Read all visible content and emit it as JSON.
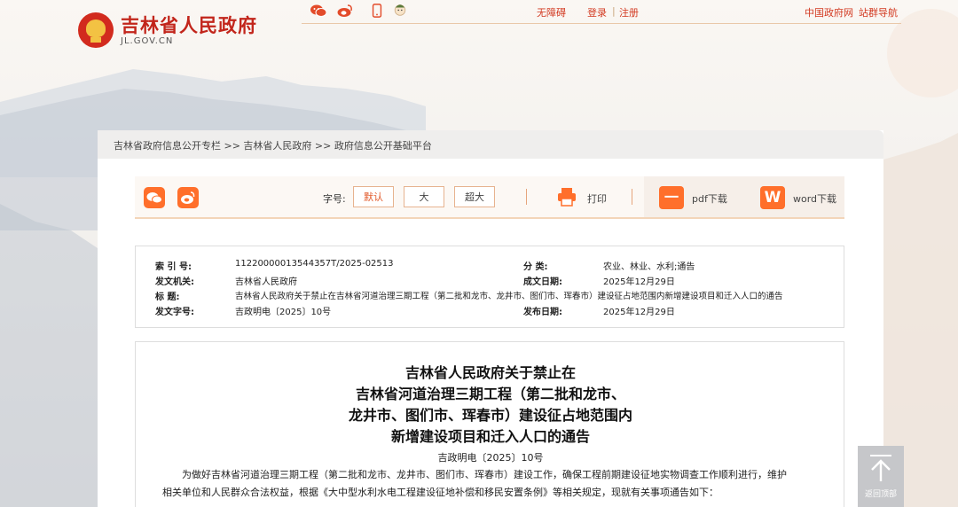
{
  "header": {
    "title": "吉林省人民政府",
    "domain": "JL.GOV.CN",
    "top_links": {
      "accessibility": "无障碍",
      "login": "登录",
      "separator": "|",
      "register": "注册",
      "china_gov": "中国政府网",
      "site_group": "站群导航"
    },
    "icons": [
      "wechat-icon",
      "weibo-icon",
      "mobile-icon",
      "avatar-icon"
    ]
  },
  "breadcrumb": "吉林省政府信息公开专栏 >> 吉林省人民政府 >> 政府信息公开基础平台",
  "toolbar": {
    "font_size_label": "字号:",
    "font_sizes": [
      "默认",
      "大",
      "超大"
    ],
    "print": "打印",
    "pdf": "pdf下载",
    "pdf_icon": "一",
    "word": "word下载",
    "word_icon": "W"
  },
  "meta": {
    "index_label": "索  引 号:",
    "index_value": "11220000013544357T/2025-02513",
    "category_label": "分  类:",
    "category_value": "农业、林业、水利;通告",
    "issuer_label": "发文机关:",
    "issuer_value": "吉林省人民政府",
    "created_label": "成文日期:",
    "created_value": "2025年12月29日",
    "title_label": "标    题:",
    "title_value": "吉林省人民政府关于禁止在吉林省河道治理三期工程（第二批和龙市、龙井市、图们市、珲春市）建设征占地范围内新增建设项目和迁入人口的通告",
    "docno_label": "发文字号:",
    "docno_value": "吉政明电〔2025〕10号",
    "published_label": "发布日期:",
    "published_value": "2025年12月29日"
  },
  "article": {
    "title_lines": [
      "吉林省人民政府关于禁止在",
      "吉林省河道治理三期工程（第二批和龙市、",
      "龙井市、图们市、珲春市）建设征占地范围内",
      "新增建设项目和迁入人口的通告"
    ],
    "doc_number": "吉政明电〔2025〕10号",
    "body_lines": [
      "为做好吉林省河道治理三期工程（第二批和龙市、龙井市、图们市、珲春市）建设工作，确保工程前期建设征地实物调查工作顺利进行，维护",
      "相关单位和人民群众合法权益，根据《大中型水利水电工程建设征地补偿和移民安置条例》等相关规定，现就有关事项通告如下："
    ]
  },
  "back_to_top": "返回顶部"
}
